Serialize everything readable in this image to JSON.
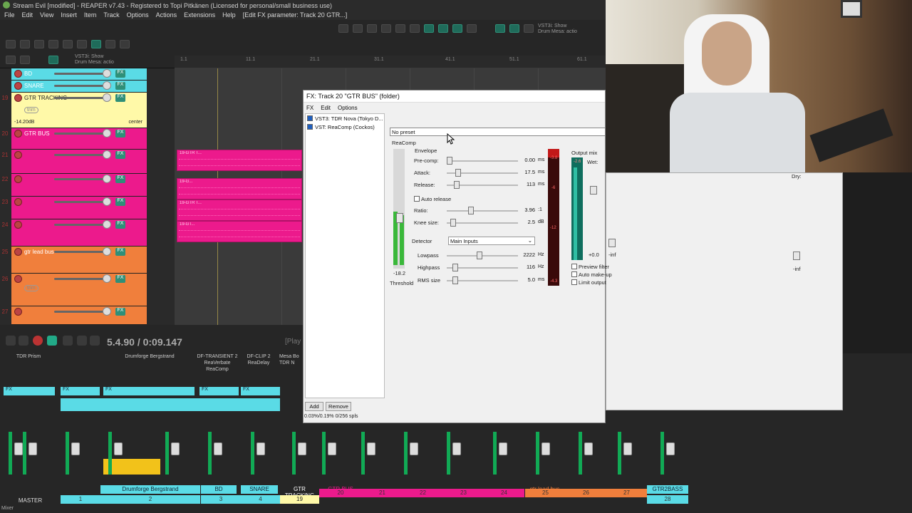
{
  "window": {
    "title": "Stream Evil [modified] - REAPER v7.43 - Registered to Topi Pitkänen (Licensed for personal/small business use)"
  },
  "menu": [
    "File",
    "Edit",
    "View",
    "Insert",
    "Item",
    "Track",
    "Options",
    "Actions",
    "Extensions",
    "Help",
    "[Edit FX parameter: Track 20 GTR...]"
  ],
  "toolbar": {
    "project_label_1": "VST3i: Show\nDrum Mesa: actio",
    "project_label_2": "VST3i: Show\nDrum Mesa: actio"
  },
  "ruler": {
    "marks": [
      "1.1",
      "11.1",
      "21.1",
      "31.1",
      "41.1",
      "51.1",
      "61.1"
    ]
  },
  "tracks": [
    {
      "name": "BD",
      "color": "#5adbe6"
    },
    {
      "name": "SNARE",
      "color": "#5adbe6"
    },
    {
      "num": "19",
      "name": "GTR TRACKING",
      "color": "#fff9a8",
      "vol": "-14.20dB",
      "pan": "center",
      "trim": "trim"
    },
    {
      "num": "20",
      "name": "GTR BUS",
      "color": "#ec1a8c"
    },
    {
      "num": "21",
      "name": "",
      "color": "#ec1a8c"
    },
    {
      "num": "22",
      "name": "",
      "color": "#ec1a8c"
    },
    {
      "num": "23",
      "name": "",
      "color": "#ec1a8c"
    },
    {
      "num": "24",
      "name": "",
      "color": "#ec1a8c"
    },
    {
      "num": "25",
      "name": "gtr lead bus",
      "color": "#f07f3c"
    },
    {
      "num": "26",
      "name": "",
      "color": "#f07f3c",
      "trim": "trim"
    },
    {
      "num": "27",
      "name": "",
      "color": "#f07f3c"
    }
  ],
  "items": {
    "labels": [
      "19-GTR T...",
      "19-G...",
      "19-GTR T...",
      "19-GT..."
    ]
  },
  "transport": {
    "time": "5.4.90 / 0:09.147",
    "status": "[Play"
  },
  "mixer": {
    "fx_chains": [
      {
        "name": "TDR Prism"
      },
      {
        "name": "Drumforge Bergstrand"
      },
      {
        "name": "DF-TRANSIENT 2\nReaVerbate\nReaComp"
      },
      {
        "name": "DF-CLIP 2\nReaDelay"
      },
      {
        "name": "Mesa Bo\nTDR N"
      }
    ],
    "strip_names": [
      {
        "name": "MASTER",
        "color": "#222",
        "text": "#ddd"
      },
      {
        "name": "Drumforge Bergstrand",
        "color": "#5adbe6",
        "text": "#123"
      },
      {
        "name": "BD",
        "color": "#5adbe6",
        "text": "#123"
      },
      {
        "name": "SNARE",
        "color": "#5adbe6",
        "text": "#123"
      },
      {
        "name": "GTR TRACKING",
        "color": "#fff9a8",
        "text": "#222"
      },
      {
        "name": "GTR BUS",
        "color": "#ec1a8c",
        "text": "#fff"
      },
      {
        "name": "gtr lead bus",
        "color": "#f07f3c",
        "text": "#222"
      },
      {
        "name": "GTR2BASS",
        "color": "#5adbe6",
        "text": "#123"
      }
    ],
    "strip_numbers": [
      "1",
      "2",
      "3",
      "4",
      "19",
      "20",
      "21",
      "22",
      "23",
      "24",
      "25",
      "26",
      "27",
      "28"
    ],
    "mixer_label": "Mixer"
  },
  "fx": {
    "title": "FX: Track 20 \"GTR BUS\" (folder)",
    "menu": [
      "FX",
      "Edit",
      "Options"
    ],
    "chain": [
      {
        "label": "VST3: TDR Nova (Tokyo D...",
        "enabled": true
      },
      {
        "label": "VST: ReaComp (Cockos)",
        "enabled": true
      }
    ],
    "preset": "No preset",
    "plugin_name": "ReaComp",
    "threshold_value": "-18.2",
    "threshold_label": "Threshold",
    "envelope_label": "Envelope",
    "params": [
      {
        "label": "Pre-comp:",
        "value": "0.00",
        "unit": "ms",
        "pos": 0.0
      },
      {
        "label": "Attack:",
        "value": "17.5",
        "unit": "ms",
        "pos": 0.12
      },
      {
        "label": "Release:",
        "value": "113",
        "unit": "ms",
        "pos": 0.1
      },
      {
        "label": "Ratio:",
        "value": "3.96",
        "unit": ":1",
        "pos": 0.3
      },
      {
        "label": "Knee size:",
        "value": "2.5",
        "unit": "dB",
        "pos": 0.05
      }
    ],
    "auto_release": "Auto release",
    "detector_label": "Detector",
    "detector_value": "Main Inputs",
    "filters": [
      {
        "label": "Lowpass",
        "value": "2222",
        "unit": "Hz",
        "pos": 0.42
      },
      {
        "label": "Highpass",
        "value": "116",
        "unit": "Hz",
        "pos": 0.08
      },
      {
        "label": "RMS size",
        "value": "5.0",
        "unit": "ms",
        "pos": 0.08
      }
    ],
    "gr_meter_top": "-3.8",
    "gr_ticks": [
      "-6",
      "-12",
      "-4.3"
    ],
    "output_mix": "Output mix",
    "wet": "Wet:",
    "dry": "Dry:",
    "wet_value": "+0.0",
    "wet_inf": "-inf",
    "dry_inf": "-inf",
    "out_peak": "-2.6",
    "checkboxes": [
      "Preview filter",
      "Auto make-up",
      "Limit output"
    ],
    "add": "Add",
    "remove": "Remove",
    "cpu": "0.03%/0.19% 0/256 spls"
  }
}
